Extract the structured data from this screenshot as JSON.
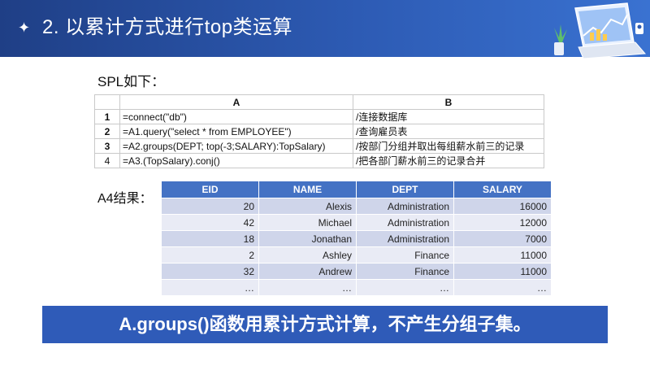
{
  "header": {
    "title": "2. 以累计方式进行top类运算"
  },
  "spl_label": "SPL如下：",
  "spl_grid": {
    "col_headers": [
      "A",
      "B"
    ],
    "rows": [
      {
        "num": "1",
        "a": "=connect(\"db\")",
        "b": "/连接数据库"
      },
      {
        "num": "2",
        "a": "=A1.query(\"select * from EMPLOYEE\")",
        "b": "/查询雇员表"
      },
      {
        "num": "3",
        "a": "=A2.groups(DEPT; top(-3;SALARY):TopSalary)",
        "b": "/按部门分组并取出每组薪水前三的记录"
      },
      {
        "num": "4",
        "a": "=A3.(TopSalary).conj()",
        "b": "/把各部门薪水前三的记录合并"
      }
    ]
  },
  "result_label": "A4结果：",
  "result_table": {
    "headers": [
      "EID",
      "NAME",
      "DEPT",
      "SALARY"
    ],
    "rows": [
      [
        "20",
        "Alexis",
        "Administration",
        "16000"
      ],
      [
        "42",
        "Michael",
        "Administration",
        "12000"
      ],
      [
        "18",
        "Jonathan",
        "Administration",
        "7000"
      ],
      [
        "2",
        "Ashley",
        "Finance",
        "11000"
      ],
      [
        "32",
        "Andrew",
        "Finance",
        "11000"
      ],
      [
        "…",
        "…",
        "…",
        "…"
      ]
    ]
  },
  "banner": {
    "text": "A.groups()函数用累计方式计算，不产生分组子集。"
  },
  "colors": {
    "header_bg": "#2d5bb4",
    "table_header": "#4472c4",
    "row_dark": "#cfd5ea",
    "row_light": "#e9ebf5",
    "banner_bg": "#2f5bb8"
  }
}
